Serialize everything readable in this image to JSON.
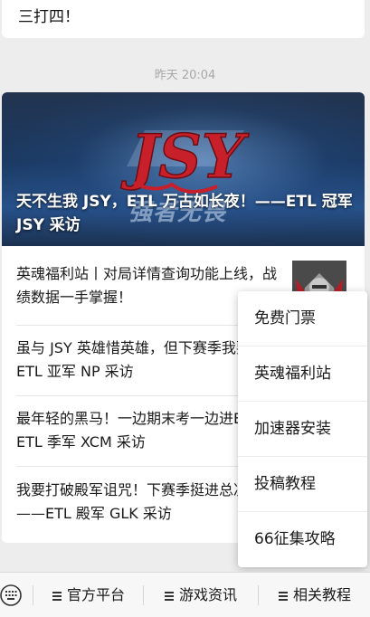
{
  "previous_message": {
    "text": "三打四！"
  },
  "timestamp": "昨天 20:04",
  "article_card": {
    "banner": {
      "title": "天不生我 JSY，ETL 万古如长夜！——ETL 冠军 JSY 采访",
      "logo_text": "JSY",
      "overlay_text": "强者无畏"
    },
    "items": [
      {
        "title": "英魂福利站丨对局详情查询功能上线，战绩数据一手掌握！"
      },
      {
        "title": "虽与 JSY 英雄惜英雄，但下赛季我要当冠军！——ETL 亚军 NP 采访"
      },
      {
        "title": "最年轻的黑马！一边期末考一边进ETL四强！——ETL 季军 XCM 采访"
      },
      {
        "title": "我要打破殿军诅咒！下赛季挺进总决赛才算成功！——ETL 殿军 GLK 采访"
      }
    ]
  },
  "popup_menu": {
    "items": [
      {
        "label": "免费门票"
      },
      {
        "label": "英魂福利站"
      },
      {
        "label": "加速器安装"
      },
      {
        "label": "投稿教程"
      },
      {
        "label": "66征集攻略"
      }
    ]
  },
  "tabbar": {
    "keyboard_icon": "keyboard-icon",
    "tabs": [
      {
        "label": "官方平台",
        "icon": "menu-icon"
      },
      {
        "label": "游戏资讯",
        "icon": "menu-icon"
      },
      {
        "label": "相关教程",
        "icon": "menu-icon"
      }
    ]
  },
  "colors": {
    "background": "#ededed",
    "card": "#ffffff",
    "logo_red": "#c8202a"
  }
}
